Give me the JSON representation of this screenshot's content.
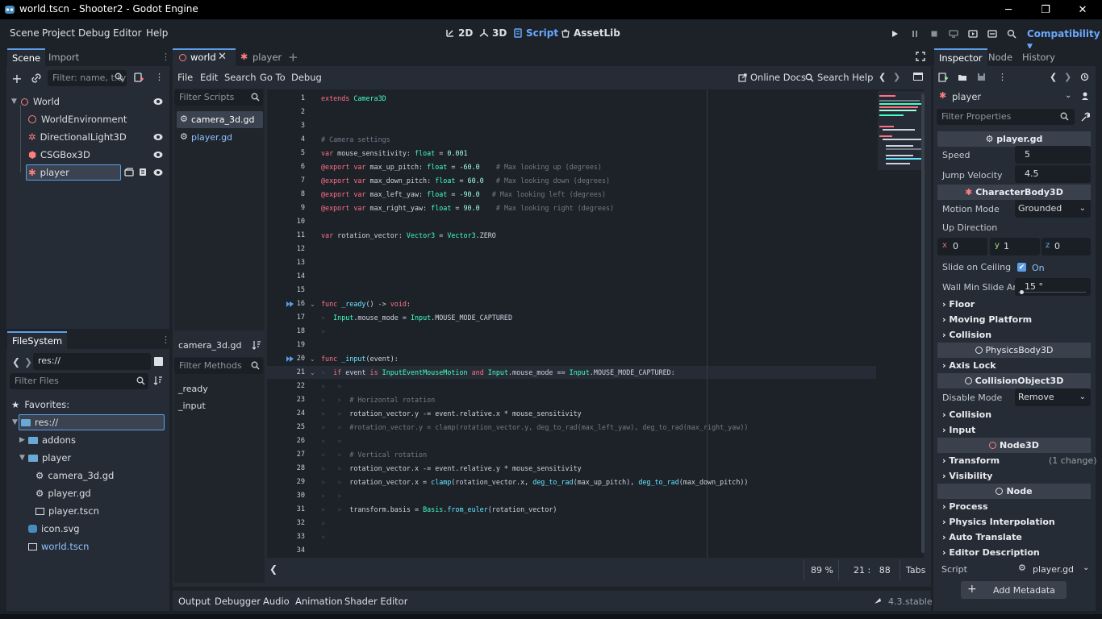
{
  "window": {
    "title": "world.tscn - Shooter2 - Godot Engine",
    "minimize": "─",
    "restore": "❐",
    "close": "✕"
  },
  "main_menu": [
    "Scene",
    "Project",
    "Debug",
    "Editor",
    "Help"
  ],
  "workspaces": [
    {
      "label": "2D",
      "icon": "2d-icon"
    },
    {
      "label": "3D",
      "icon": "3d-icon"
    },
    {
      "label": "Script",
      "icon": "script-icon",
      "active": true
    },
    {
      "label": "AssetLib",
      "icon": "assetlib-icon"
    }
  ],
  "renderer": "Compatibility",
  "scene_dock": {
    "tabs": [
      "Scene",
      "Import"
    ],
    "filter_placeholder": "Filter: name, t:ty",
    "nodes": [
      {
        "label": "World",
        "icon": "node3d-icon",
        "color": "#fc7f7f"
      },
      {
        "label": "WorldEnvironment",
        "icon": "world-environment-icon",
        "color": "#fc7f7f"
      },
      {
        "label": "DirectionalLight3D",
        "icon": "light-icon",
        "color": "#fc7f7f"
      },
      {
        "label": "CSGBox3D",
        "icon": "csg-box-icon",
        "color": "#fc7f7f"
      },
      {
        "label": "player",
        "icon": "character-body-icon",
        "color": "#fc7f7f"
      }
    ]
  },
  "filesystem": {
    "tab": "FileSystem",
    "path": "res://",
    "filter_placeholder": "Filter Files",
    "items": [
      {
        "label": "Favorites:"
      },
      {
        "label": "res://"
      },
      {
        "label": "addons"
      },
      {
        "label": "player"
      },
      {
        "label": "camera_3d.gd"
      },
      {
        "label": "player.gd"
      },
      {
        "label": "player.tscn"
      },
      {
        "label": "icon.svg"
      },
      {
        "label": "world.tscn"
      }
    ]
  },
  "editor_tabs": [
    {
      "label": "world"
    },
    {
      "label": "player"
    }
  ],
  "script_menu": [
    "File",
    "Edit",
    "Search",
    "Go To",
    "Debug"
  ],
  "script_actions": {
    "online_docs": "Online Docs",
    "search_help": "Search Help"
  },
  "scripts_panel": {
    "filter_placeholder": "Filter Scripts",
    "scripts": [
      "camera_3d.gd",
      "player.gd"
    ],
    "current": "camera_3d.gd",
    "methods_placeholder": "Filter Methods",
    "methods": [
      "_ready",
      "_input"
    ]
  },
  "code_lines": [
    "1",
    "2",
    "3",
    "4",
    "5",
    "6",
    "7",
    "8",
    "9",
    "10",
    "11",
    "12",
    "13",
    "14",
    "15",
    "16",
    "17",
    "18",
    "19",
    "20",
    "21",
    "22",
    "23",
    "24",
    "25",
    "26",
    "27",
    "28",
    "29",
    "30",
    "31",
    "32",
    "33",
    "34"
  ],
  "status": {
    "zoom": "89 %",
    "position": "21 :   88",
    "indent": "Tabs"
  },
  "bottom_tabs": [
    "Output",
    "Debugger",
    "Audio",
    "Animation",
    "Shader Editor"
  ],
  "version": "4.3.stable",
  "inspector": {
    "tabs": [
      "Inspector",
      "Node",
      "History"
    ],
    "object": "player",
    "filter_placeholder": "Filter Properties",
    "script_section": "player.gd",
    "speed_label": "Speed",
    "speed": "5",
    "jump_label": "Jump Velocity",
    "jump": "4.5",
    "cb_section": "CharacterBody3D",
    "motion_mode_label": "Motion Mode",
    "motion_mode": "Grounded",
    "up_direction_label": "Up Direction",
    "up": {
      "x_label": "x",
      "x": "0",
      "y_label": "y",
      "y": "1",
      "z_label": "z",
      "z": "0"
    },
    "slide_ceiling_label": "Slide on Ceiling",
    "slide_ceiling": "On",
    "wall_min_label": "Wall Min Slide An",
    "wall_min": "15 °",
    "cats1": [
      "Floor",
      "Moving Platform",
      "Collision"
    ],
    "pb_section": "PhysicsBody3D",
    "cats2": [
      "Axis Lock"
    ],
    "co_section": "CollisionObject3D",
    "disable_mode_label": "Disable Mode",
    "disable_mode": "Remove",
    "cats3": [
      "Collision",
      "Input"
    ],
    "n3d_section": "Node3D",
    "transform": "Transform",
    "transform_note": "(1 change)",
    "visibility": "Visibility",
    "node_section": "Node",
    "cats4": [
      "Process",
      "Physics Interpolation",
      "Auto Translate",
      "Editor Description"
    ],
    "script_label": "Script",
    "script_value": "player.gd",
    "add_metadata": "Add Metadata"
  }
}
